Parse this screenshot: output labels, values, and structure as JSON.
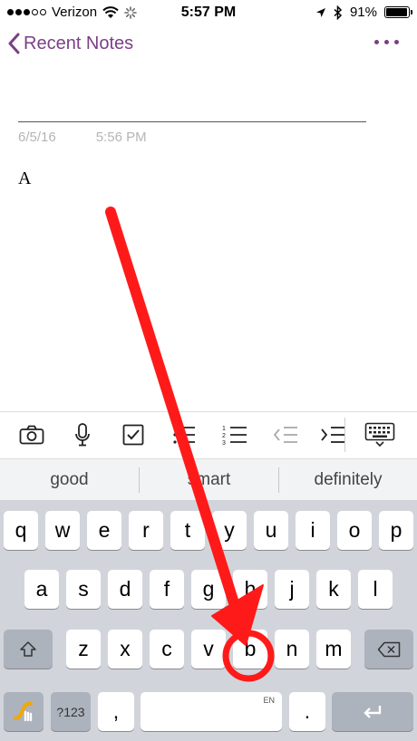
{
  "status_bar": {
    "carrier": "Verizon",
    "time": "5:57 PM",
    "battery": "91%"
  },
  "nav": {
    "back_label": "Recent Notes"
  },
  "note": {
    "date": "6/5/16",
    "time": "5:56 PM",
    "body": "A"
  },
  "suggestions": [
    "good",
    "smart",
    "definitely"
  ],
  "keyboard": {
    "row1": [
      "q",
      "w",
      "e",
      "r",
      "t",
      "y",
      "u",
      "i",
      "o",
      "p"
    ],
    "row2": [
      "a",
      "s",
      "d",
      "f",
      "g",
      "h",
      "j",
      "k",
      "l"
    ],
    "row3": [
      "z",
      "x",
      "c",
      "v",
      "b",
      "n",
      "m"
    ],
    "numbers_label": "?123",
    "comma": ",",
    "language": "EN",
    "period": "."
  },
  "colors": {
    "accent": "#7b3f86",
    "annotation": "#ff1a1a"
  }
}
